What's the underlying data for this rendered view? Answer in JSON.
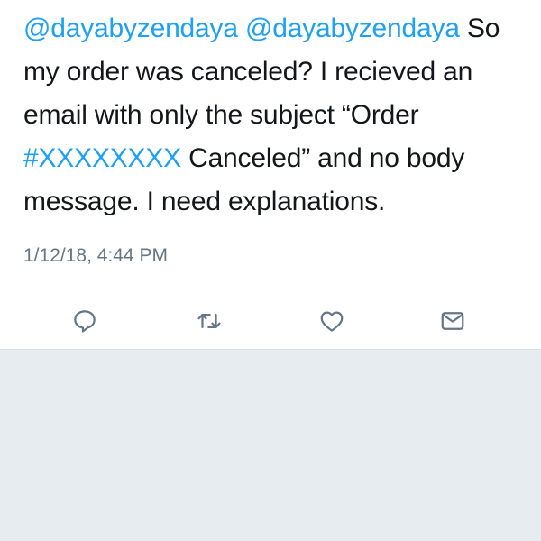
{
  "tweet": {
    "mention_1": "@dayabyzendaya",
    "mention_2": "@dayabyzendaya",
    "text_1": "So my order was canceled? I recieved an email with only the subject “Order ",
    "hashtag": "#XXXXXXXX",
    "text_2": " Canceled” and no body message. I need explanations.",
    "timestamp": "1/12/18, 4:44 PM"
  },
  "actions": [
    {
      "icon": "reply-icon"
    },
    {
      "icon": "retweet-icon"
    },
    {
      "icon": "like-icon"
    },
    {
      "icon": "direct-message-icon"
    }
  ],
  "colors": {
    "link": "#1da1f2",
    "text": "#14171a",
    "muted": "#657786",
    "background": "#e6ecf0"
  }
}
